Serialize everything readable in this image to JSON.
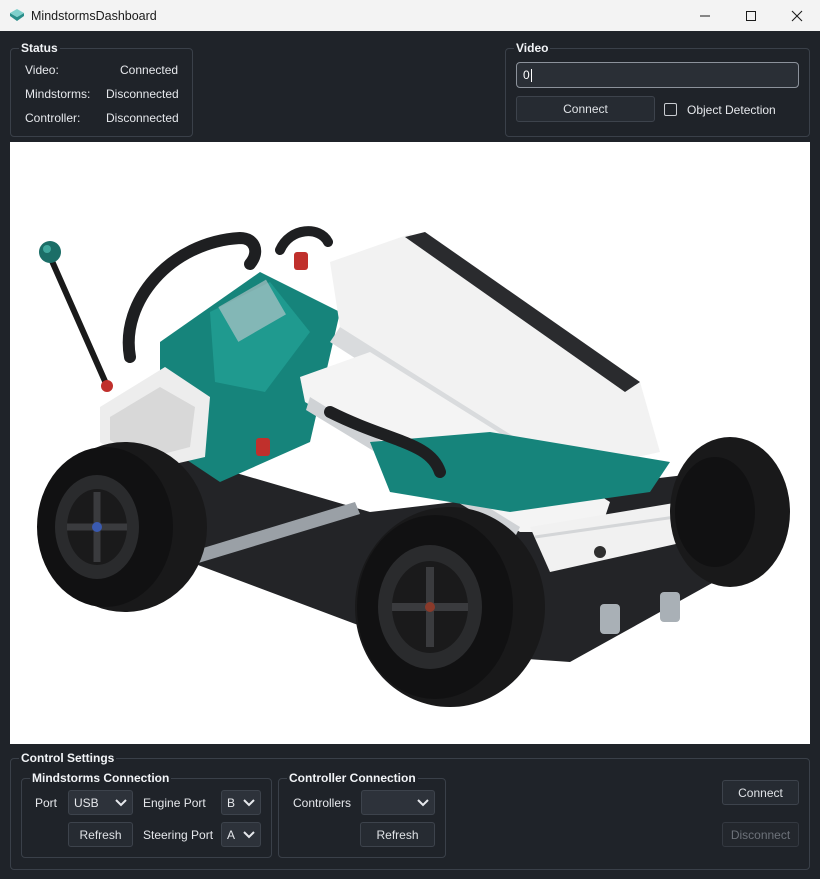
{
  "window": {
    "title": "MindstormsDashboard",
    "icon": "app-icon"
  },
  "status": {
    "title": "Status",
    "rows": [
      {
        "label": "Video:",
        "value": "Connected"
      },
      {
        "label": "Mindstorms:",
        "value": "Disconnected"
      },
      {
        "label": "Controller:",
        "value": "Disconnected"
      }
    ]
  },
  "video": {
    "title": "Video",
    "source_value": "0",
    "connect_label": "Connect",
    "object_detection_label": "Object Detection",
    "object_detection_checked": false
  },
  "control_settings": {
    "title": "Control Settings",
    "mindstorms": {
      "title": "Mindstorms Connection",
      "port_label": "Port",
      "port_value": "USB",
      "engine_port_label": "Engine Port",
      "engine_port_value": "B",
      "steering_port_label": "Steering Port",
      "steering_port_value": "A",
      "refresh_label": "Refresh"
    },
    "controller": {
      "title": "Controller Connection",
      "controllers_label": "Controllers",
      "controllers_value": "",
      "refresh_label": "Refresh"
    },
    "connect_label": "Connect",
    "disconnect_label": "Disconnect"
  },
  "colors": {
    "background": "#1f2329",
    "border": "#3a4049",
    "robot_teal": "#16847b"
  }
}
